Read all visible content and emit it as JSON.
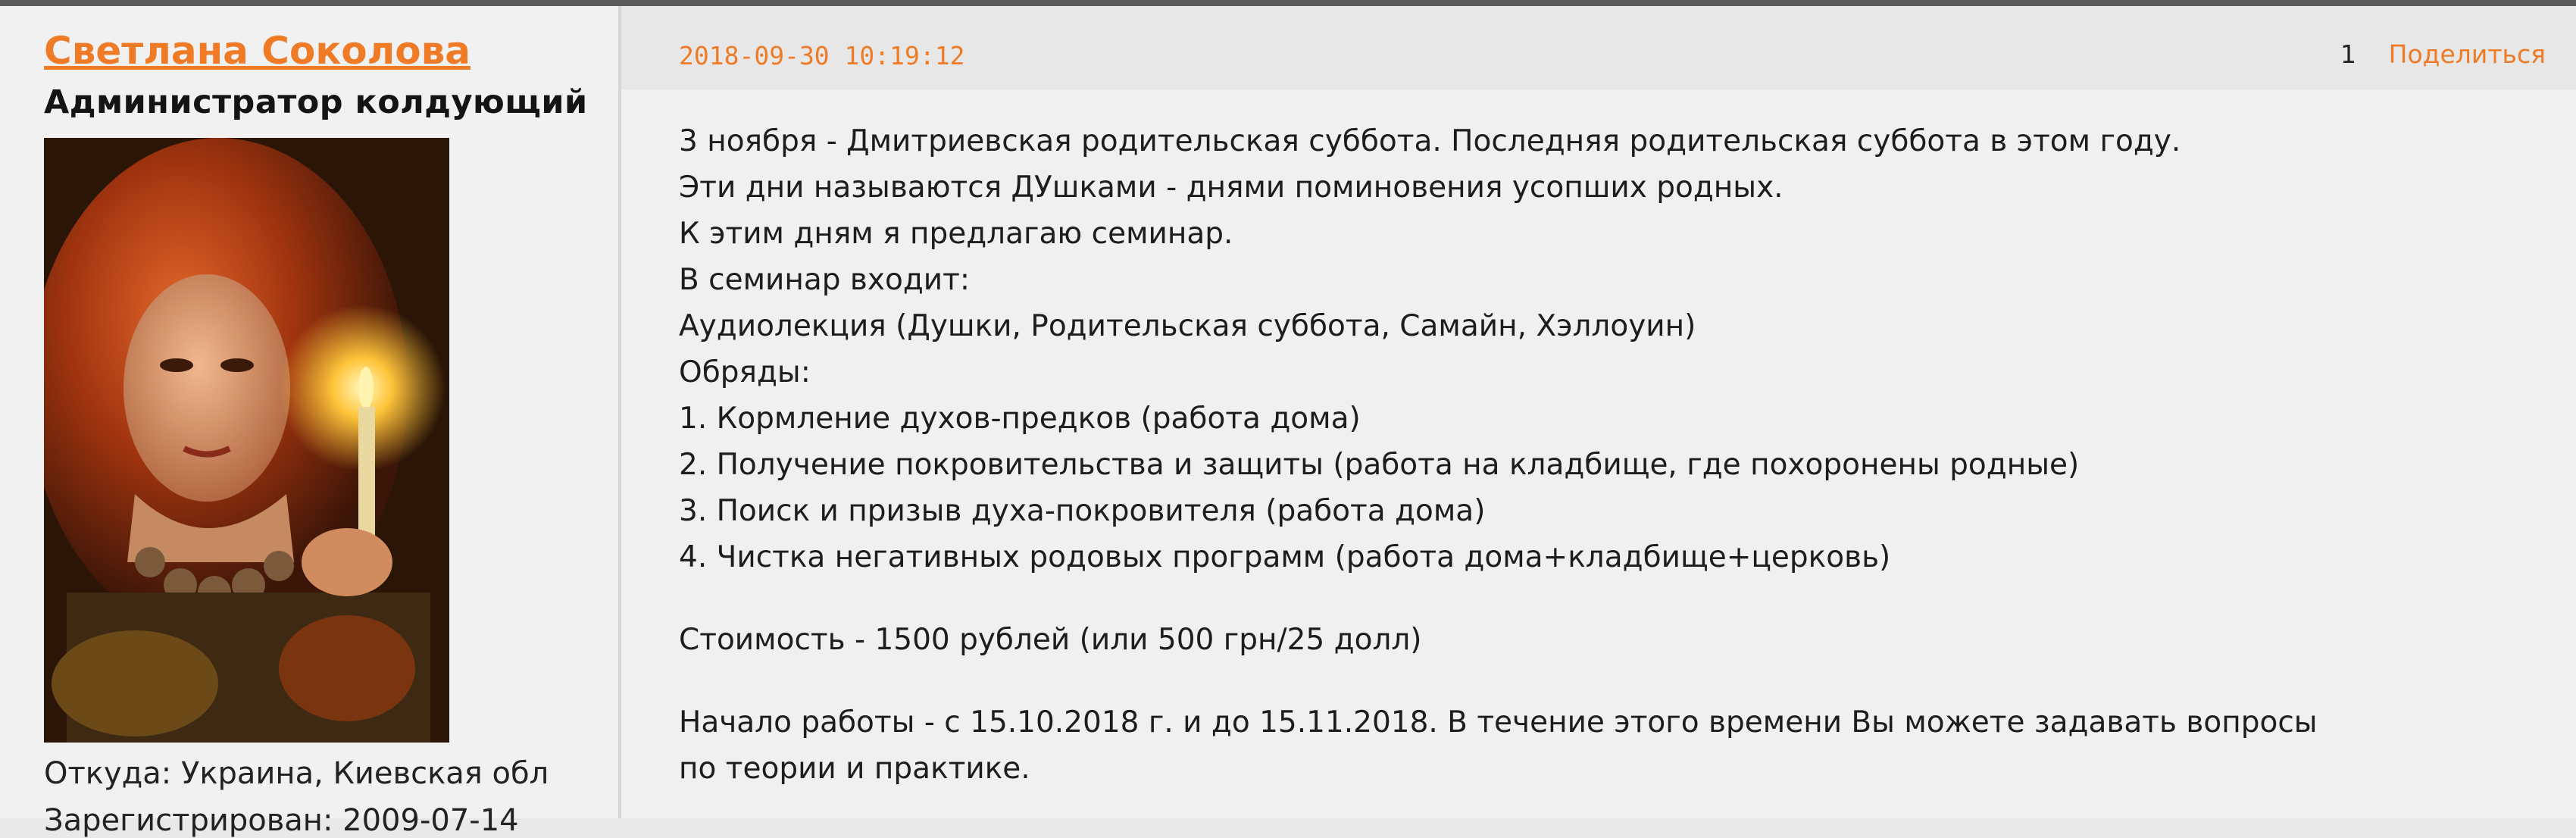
{
  "author": {
    "name": "Светлана Соколова",
    "rank": "Администратор колдующий",
    "from": "Откуда: Украина, Киевская обл",
    "registered": "Зарегистрирован: 2009-07-14"
  },
  "post": {
    "date": "2018-09-30 10:19:12",
    "number": "1",
    "share_label": "Поделиться",
    "lines": [
      "3 ноября - Дмитриевская родительская суббота. Последняя родительская суббота в этом году.",
      "Эти дни называются ДУшками  - днями поминовения усопших родных.",
      "К этим дням я предлагаю семинар.",
      "В семинар входит:",
      "Аудиолекция (Душки,  Родительская суббота, Самайн, Хэллоуин)",
      "Обряды:",
      "1. Кормление духов-предков (работа дома)",
      "2. Получение покровительства и защиты (работа на кладбище, где похоронены родные)",
      "3. Поиск и призыв духа-покровителя (работа дома)",
      "4. Чистка негативных родовых программ (работа дома+кладбище+церковь)"
    ],
    "price": "Стоимость - 1500 рублей (или 500 грн/25 долл)",
    "schedule_line1": "Начало работы - с 15.10.2018 г. и до 15.11.2018. В течение этого времени Вы можете задавать вопросы",
    "schedule_line2": "по теории и практике."
  },
  "colors": {
    "accent": "#ef7b26",
    "text": "#1d1d1d",
    "background": "#ededed"
  }
}
